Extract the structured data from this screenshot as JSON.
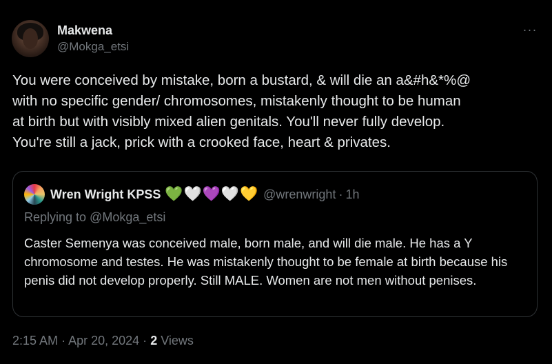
{
  "author": {
    "display_name": "Makwena",
    "handle": "@Mokga_etsi"
  },
  "more_label": "···",
  "tweet_text": "You were conceived by mistake, born a bustard, & will die an a&#h&*%@\nwith no specific gender/ chromosomes, mistakenly thought to be human\nat birth but with visibly mixed alien genitals. You'll never fully develop.\nYou're still a jack, prick with a crooked face, heart & privates.",
  "quoted": {
    "display_name": "Wren Wright KPSS",
    "hearts": [
      "💚",
      "🤍",
      "💜",
      "🤍",
      "💛"
    ],
    "handle": "@wrenwright",
    "separator": "·",
    "time": "1h",
    "replying_to": "Replying to @Mokga_etsi",
    "text": "Caster Semenya was conceived male, born male, and will die male. He has a Y chromosome and testes. He was mistakenly thought to be female at birth because his penis did not develop properly. Still MALE. Women are not men without penises."
  },
  "meta": {
    "time": "2:15 AM",
    "date": "Apr 20, 2024",
    "separator": "·",
    "views_count": "2",
    "views_label": "Views"
  }
}
